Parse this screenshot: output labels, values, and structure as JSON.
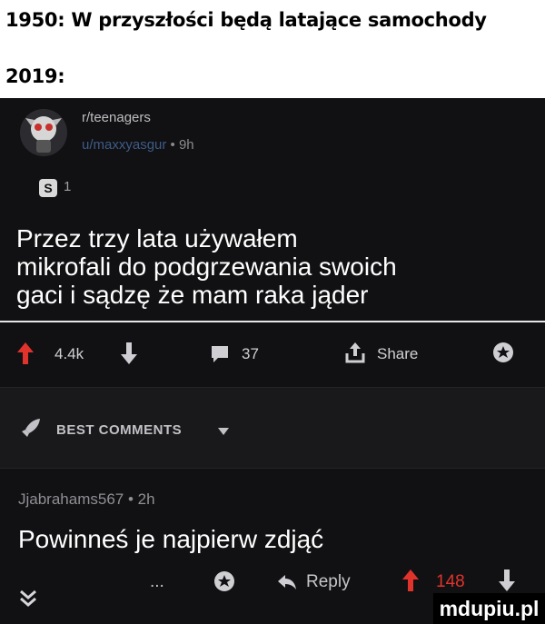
{
  "meme": {
    "line1": "1950: W przyszłości będą latające samochody",
    "line2": "2019:"
  },
  "post": {
    "subreddit": "r/teenagers",
    "username": "u/maxxyasgur",
    "age": "9h",
    "award_count": "1",
    "award_glyph": "S",
    "title": "Przez trzy lata używałem\nmikrofali do podgrzewania swoich\ngaci i sądzę że mam raka jąder",
    "upvotes": "4.4k",
    "comments": "37",
    "share_label": "Share"
  },
  "comments_header": "BEST COMMENTS",
  "comment": {
    "author": "Jjabrahams567",
    "age": "2h",
    "text": "Powinneś je najpierw zdjąć",
    "more": "...",
    "reply_label": "Reply",
    "score": "148"
  },
  "watermark": "mdupiu.pl",
  "colors": {
    "upvote": "#e0332b",
    "username": "#3d5b88",
    "panel_bg": "#111113"
  }
}
